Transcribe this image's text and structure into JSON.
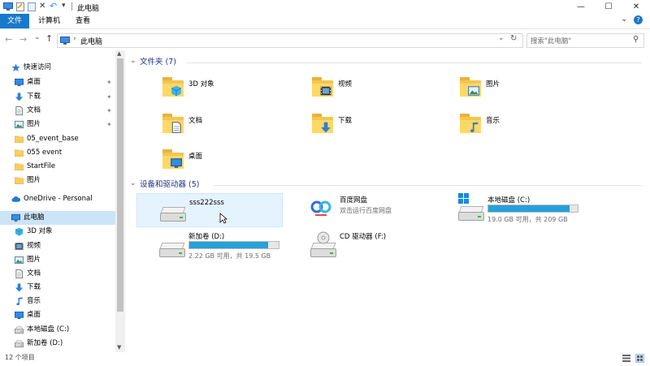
{
  "window": {
    "title": "此电脑",
    "qat_dropdown": "▾",
    "controls": {
      "minimize": "—",
      "maximize": "☐",
      "close": "✕"
    }
  },
  "ribbon": {
    "tabs": [
      {
        "label": "文件",
        "active": true
      },
      {
        "label": "计算机",
        "active": false
      },
      {
        "label": "查看",
        "active": false
      }
    ],
    "collapse_glyph": "⌄",
    "help_glyph": "?"
  },
  "address": {
    "back": "←",
    "forward": "→",
    "history": "⌄",
    "up": "↑",
    "separator": "›",
    "path": "此电脑",
    "dropdown": "⌄",
    "refresh": "↻",
    "search_placeholder": "搜索\"此电脑\"",
    "search_glyph": "⚲"
  },
  "nav": {
    "items": [
      {
        "label": "快速访问",
        "icon": "star-icon",
        "pinned": false,
        "indent": 0
      },
      {
        "label": "桌面",
        "icon": "desktop-icon",
        "pinned": true,
        "indent": 1
      },
      {
        "label": "下载",
        "icon": "download-icon",
        "pinned": true,
        "indent": 1
      },
      {
        "label": "文档",
        "icon": "document-icon",
        "pinned": true,
        "indent": 1
      },
      {
        "label": "图片",
        "icon": "picture-icon",
        "pinned": true,
        "indent": 1
      },
      {
        "label": "05_event_base",
        "icon": "folder-icon",
        "pinned": false,
        "indent": 1
      },
      {
        "label": "055 event",
        "icon": "folder-icon",
        "pinned": false,
        "indent": 1
      },
      {
        "label": "StartFile",
        "icon": "folder-icon",
        "pinned": false,
        "indent": 1
      },
      {
        "label": "图片",
        "icon": "folder-icon",
        "pinned": false,
        "indent": 1
      },
      {
        "label": "OneDrive - Personal",
        "icon": "cloud-icon",
        "pinned": false,
        "indent": 0
      },
      {
        "label": "此电脑",
        "icon": "computer-icon",
        "pinned": false,
        "indent": 0,
        "selected": true
      },
      {
        "label": "3D 对象",
        "icon": "cube-icon",
        "pinned": false,
        "indent": 1
      },
      {
        "label": "视频",
        "icon": "video-icon",
        "pinned": false,
        "indent": 1
      },
      {
        "label": "图片",
        "icon": "picture-icon",
        "pinned": false,
        "indent": 1
      },
      {
        "label": "文档",
        "icon": "document-icon",
        "pinned": false,
        "indent": 1
      },
      {
        "label": "下载",
        "icon": "download-icon",
        "pinned": false,
        "indent": 1
      },
      {
        "label": "音乐",
        "icon": "music-icon",
        "pinned": false,
        "indent": 1
      },
      {
        "label": "桌面",
        "icon": "desktop-icon",
        "pinned": false,
        "indent": 1
      },
      {
        "label": "本地磁盘 (C:)",
        "icon": "drive-icon",
        "pinned": false,
        "indent": 1
      },
      {
        "label": "新加卷 (D:)",
        "icon": "drive-icon",
        "pinned": false,
        "indent": 1
      }
    ],
    "pin_glyph": "✦"
  },
  "folders_group": {
    "header": "文件夹 (7)",
    "items": [
      {
        "label": "3D 对象",
        "icon": "cube-icon"
      },
      {
        "label": "视频",
        "icon": "video-icon"
      },
      {
        "label": "图片",
        "icon": "picture-icon"
      },
      {
        "label": "文档",
        "icon": "document-icon"
      },
      {
        "label": "下载",
        "icon": "download-icon"
      },
      {
        "label": "音乐",
        "icon": "music-icon"
      },
      {
        "label": "桌面",
        "icon": "desktop-icon"
      }
    ]
  },
  "devices_group": {
    "header": "设备和驱动器 (5)",
    "items": [
      {
        "label": "sss222sss",
        "sub": "",
        "icon": "drive-icon",
        "has_bar": false
      },
      {
        "label": "百度网盘",
        "sub": "双击运行百度网盘",
        "icon": "baidu-netdisk-icon",
        "has_bar": false
      },
      {
        "label": "本地磁盘 (C:)",
        "sub": "19.0 GB 可用，共 209 GB",
        "icon": "windows-drive-icon",
        "has_bar": true,
        "fill": 0.91
      },
      {
        "label": "新加卷 (D:)",
        "sub": "2.22 GB 可用，共 19.5 GB",
        "icon": "drive-icon",
        "has_bar": true,
        "fill": 0.886
      },
      {
        "label": "CD 驱动器 (F:)",
        "sub": "",
        "icon": "cd-drive-icon",
        "has_bar": false
      }
    ]
  },
  "status": {
    "count": "12 个项目"
  },
  "colors": {
    "accent": "#1979ca",
    "drive_bar": "#26a0da",
    "group_header": "#1e3287",
    "selection": "#cce4f7"
  }
}
